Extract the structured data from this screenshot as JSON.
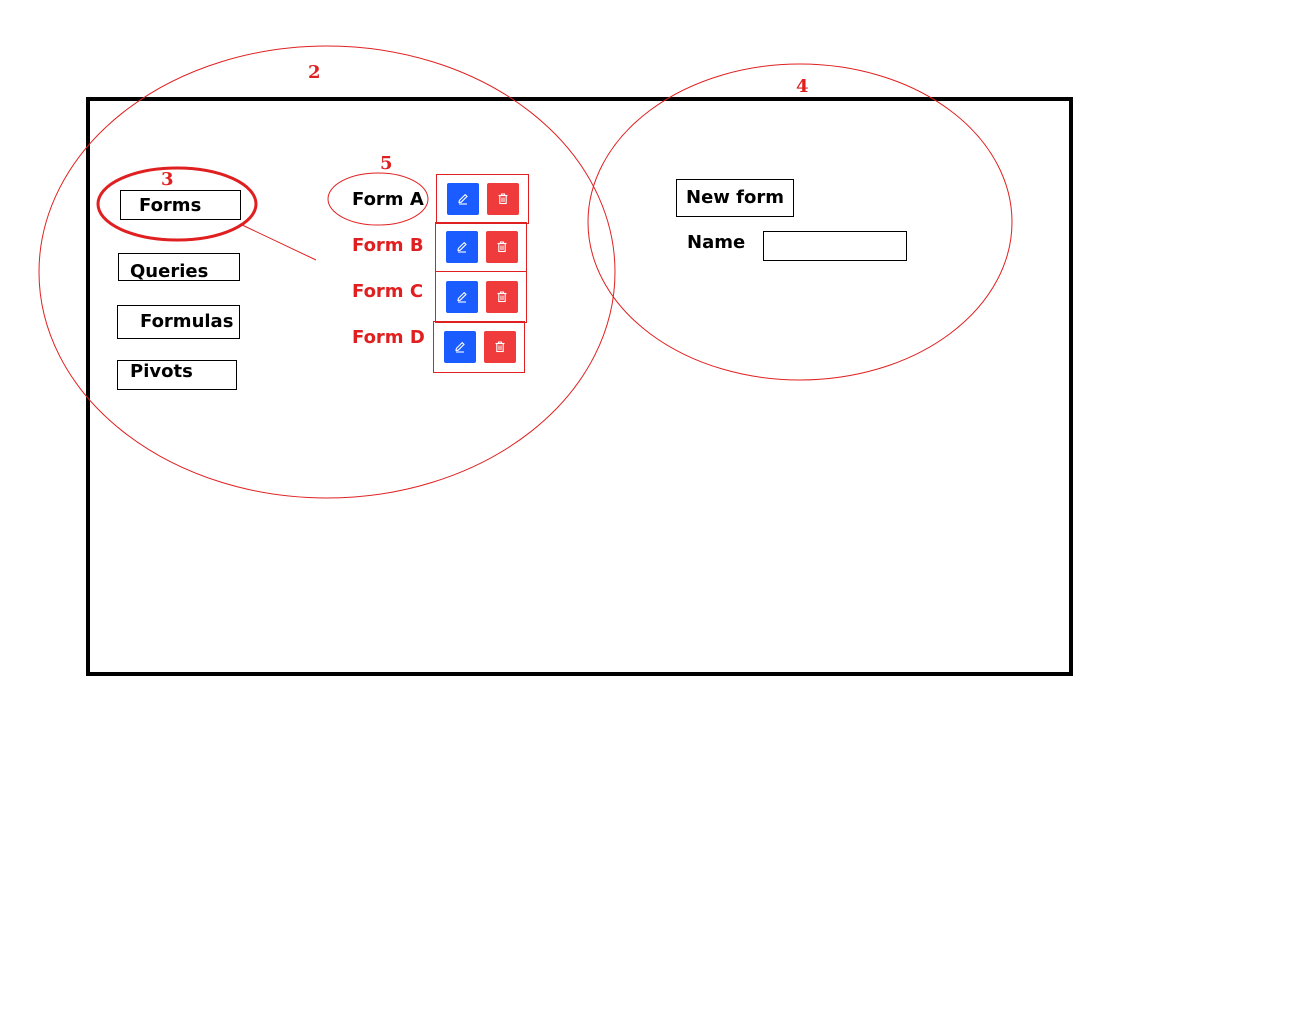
{
  "nav": {
    "items": [
      {
        "label": "Forms"
      },
      {
        "label": "Queries"
      },
      {
        "label": "Formulas"
      },
      {
        "label": "Pivots"
      }
    ]
  },
  "forms_list": {
    "items": [
      {
        "label": "Form A",
        "active": true
      },
      {
        "label": "Form B",
        "active": false
      },
      {
        "label": "Form C",
        "active": false
      },
      {
        "label": "Form D",
        "active": false
      }
    ],
    "edit_icon": "pencil-icon",
    "delete_icon": "trash-icon"
  },
  "new_form": {
    "title": "New form",
    "name_label": "Name",
    "name_value": ""
  },
  "annotations": {
    "numbers": [
      "2",
      "3",
      "4",
      "5"
    ]
  },
  "colors": {
    "annotation_red": "#e02020",
    "edit_blue": "#1a5cff",
    "delete_red": "#ef3b3b"
  }
}
